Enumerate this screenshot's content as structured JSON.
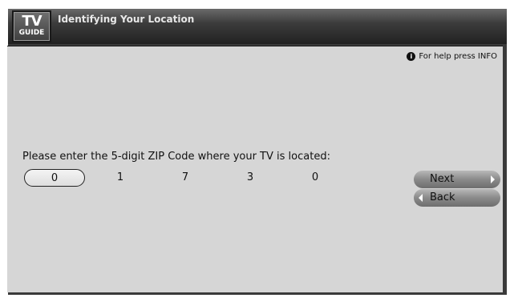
{
  "app": {
    "logo_top": "TV",
    "logo_bottom": "GUIDE",
    "title": "Identifying Your Location"
  },
  "help": {
    "icon": "info-icon",
    "icon_glyph": "i",
    "text": "For help press INFO"
  },
  "prompt": "Please enter the 5-digit ZIP Code where your TV is located:",
  "zip": {
    "digits": [
      "0",
      "1",
      "7",
      "3",
      "0"
    ],
    "selected_index": 0
  },
  "nav": {
    "next_label": "Next",
    "back_label": "Back"
  },
  "colors": {
    "panel": "#d6d6d6",
    "titlebar": "#2c2c2c",
    "button": "#8a8a8a"
  }
}
